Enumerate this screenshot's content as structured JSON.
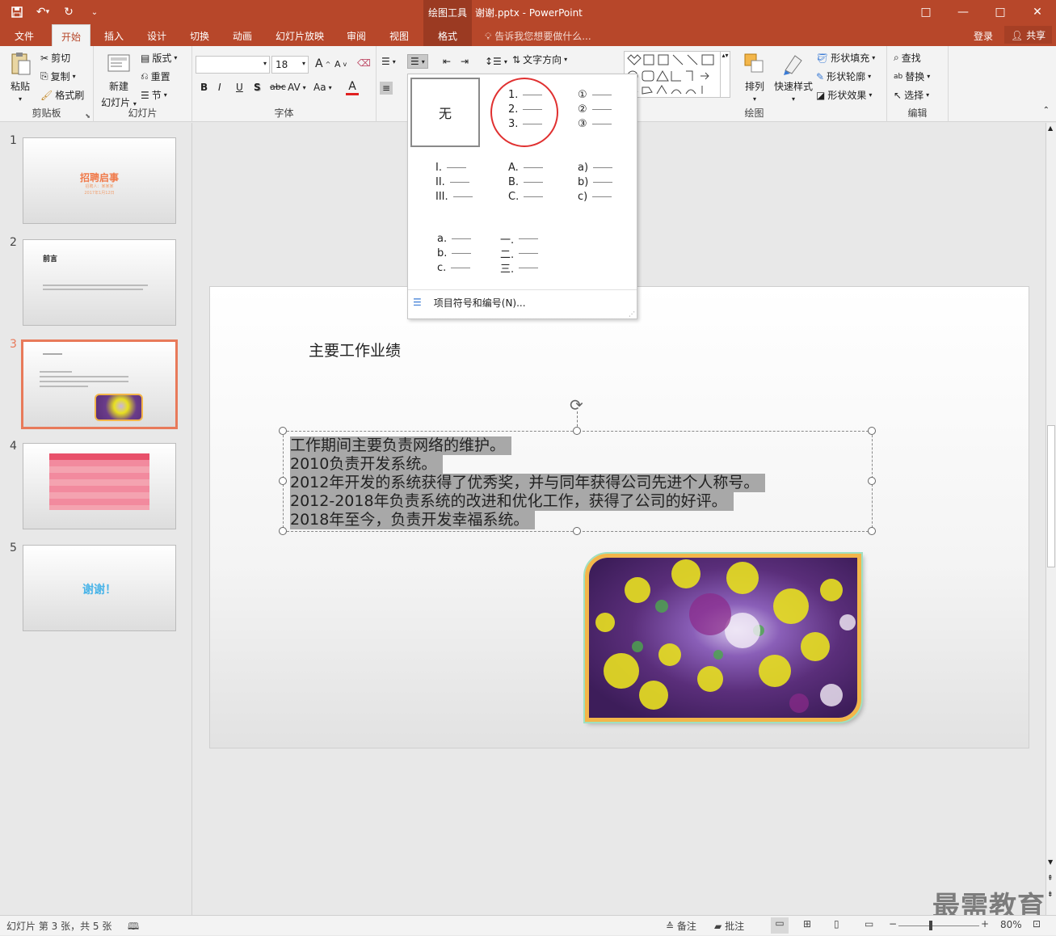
{
  "titlebar": {
    "context_tab_group": "绘图工具",
    "document_title": "谢谢.pptx - PowerPoint",
    "qat": {
      "save_icon": "save-icon",
      "undo_icon": "undo-icon",
      "redo_icon": "redo-icon",
      "customize_icon": "customize-icon"
    },
    "controls": {
      "ribbon_options": "□",
      "minimize": "—",
      "maximize": "□",
      "close": "✕"
    }
  },
  "tabs": [
    {
      "label": "文件"
    },
    {
      "label": "开始"
    },
    {
      "label": "插入"
    },
    {
      "label": "设计"
    },
    {
      "label": "切换"
    },
    {
      "label": "动画"
    },
    {
      "label": "幻灯片放映"
    },
    {
      "label": "审阅"
    },
    {
      "label": "视图"
    },
    {
      "label": "格式"
    }
  ],
  "tellme": "告诉我您想要做什么...",
  "account": {
    "login": "登录",
    "share": "共享"
  },
  "ribbon": {
    "clipboard": {
      "paste": "粘贴",
      "cut": "剪切",
      "copy": "复制",
      "format_painter": "格式刷",
      "label": "剪贴板"
    },
    "slides": {
      "new_slide_line1": "新建",
      "new_slide_line2": "幻灯片",
      "layout": "版式",
      "reset": "重置",
      "section": "节",
      "label": "幻灯片"
    },
    "font": {
      "font_name": "",
      "font_size": "18",
      "bold": "B",
      "italic": "I",
      "underline": "U",
      "shadow": "S",
      "strike": "abc",
      "spacing": "AV",
      "case": "Aa",
      "color": "A",
      "grow": "A",
      "shrink": "A",
      "label": "字体"
    },
    "paragraph": {
      "text_direction": "文字方向"
    },
    "drawing": {
      "arrange": "排列",
      "quick_styles": "快速样式",
      "fill": "形状填充",
      "outline": "形状轮廓",
      "effects": "形状效果",
      "label": "绘图"
    },
    "editing": {
      "find": "查找",
      "replace": "替换",
      "select": "选择",
      "label": "编辑"
    }
  },
  "numbering_menu": {
    "none": "无",
    "styles": [
      {
        "items": [
          "1.",
          "2.",
          "3."
        ]
      },
      {
        "items": [
          "①",
          "②",
          "③"
        ]
      },
      {
        "items": [
          "I.",
          "II.",
          "III."
        ]
      },
      {
        "items": [
          "A.",
          "B.",
          "C."
        ]
      },
      {
        "items": [
          "a)",
          "b)",
          "c)"
        ]
      },
      {
        "items": [
          "a.",
          "b.",
          "c."
        ]
      },
      {
        "items": [
          "一.",
          "二.",
          "三."
        ]
      }
    ],
    "footer": "项目符号和编号(N)..."
  },
  "thumbnails": [
    {
      "num": "1",
      "title": "招聘启事",
      "sub": "招聘人：某某某",
      "date": "2017年1月12日"
    },
    {
      "num": "2",
      "title": "前言"
    },
    {
      "num": "3"
    },
    {
      "num": "4"
    },
    {
      "num": "5",
      "title": "谢谢！"
    }
  ],
  "slide": {
    "title": "主要工作业绩",
    "lines": [
      "工作期间主要负责网络的维护。",
      "2010负责开发系统。",
      "2012年开发的系统获得了优秀奖，并与同年获得公司先进个人称号。",
      "2012-2018年负责系统的改进和优化工作，获得了公司的好评。",
      "2018年至今，负责开发幸福系统。"
    ]
  },
  "status": {
    "slide_info": "幻灯片 第 3 张，共 5 张",
    "notes": "备注",
    "comments": "批注",
    "zoom": "80%"
  },
  "watermark": "最需教育",
  "colors": {
    "accent": "#b7472a",
    "selection": "#a8a8a8",
    "selected_thumb_border": "#e87a5a",
    "highlight_circle": "#e03030"
  }
}
